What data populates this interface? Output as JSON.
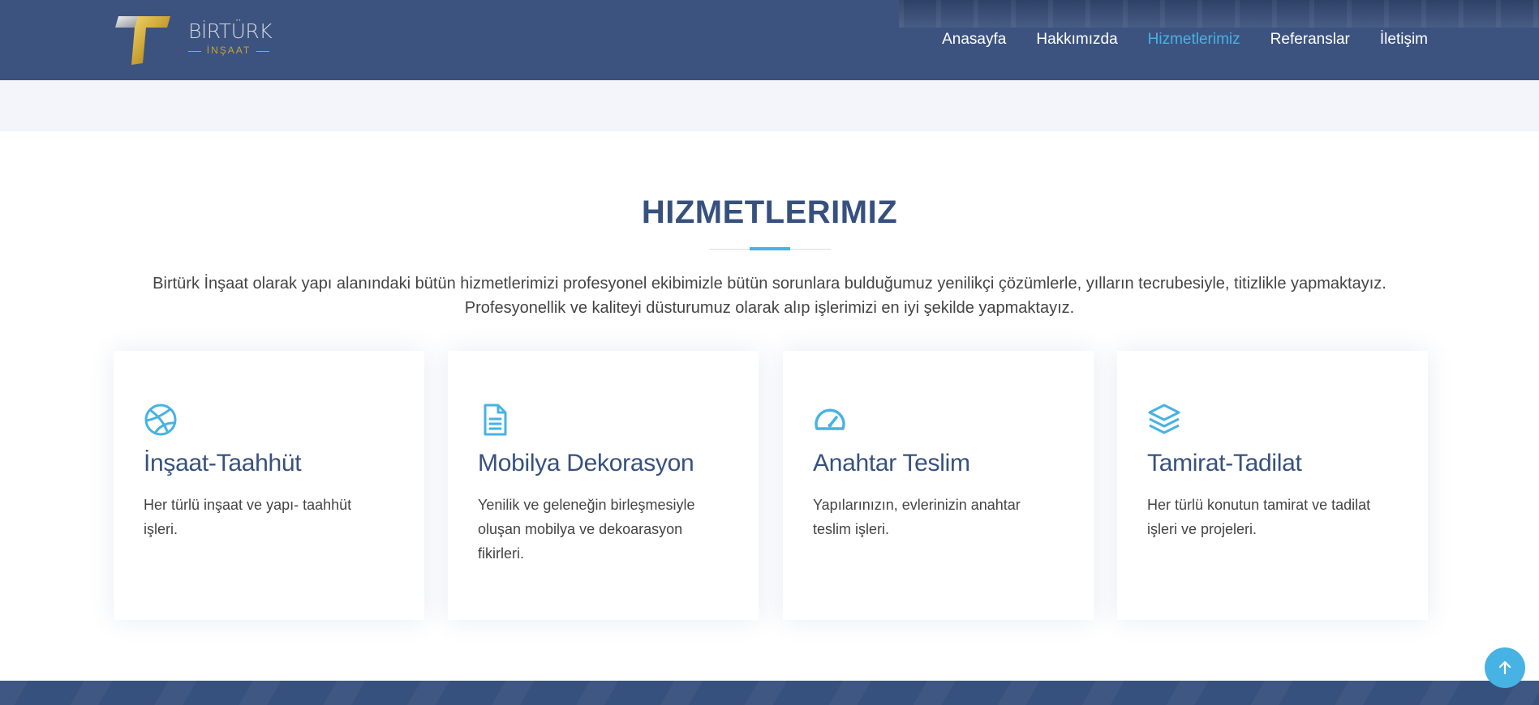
{
  "brand": {
    "name": "BİRTÜRK",
    "sub": "İNŞAAT",
    "colors": {
      "navy": "#3c5380",
      "gold": "#c9a233",
      "accent": "#47b2e4"
    }
  },
  "nav": {
    "items": [
      {
        "label": "Anasayfa"
      },
      {
        "label": "Hakkımızda"
      },
      {
        "label": "Hizmetlerimiz",
        "active": true
      },
      {
        "label": "Referanslar"
      },
      {
        "label": "İletişim"
      }
    ]
  },
  "services": {
    "title": "HIZMETLERIMIZ",
    "description_line1": "Birtürk İnşaat olarak yapı alanındaki bütün hizmetlerimizi profesyonel ekibimizle bütün sorunlara bulduğumuz yenilikçi çözümlerle, yılların tecrubesiyle, titizlikle yapmaktayız.",
    "description_line2": "Profesyonellik ve kaliteyi düsturumuz olarak alıp işlerimizi en iyi şekilde yapmaktayız.",
    "cards": [
      {
        "icon": "dribbble-icon",
        "title": "İnşaat-Taahhüt",
        "text": "Her türlü inşaat ve yapı- taahhüt işleri."
      },
      {
        "icon": "document-icon",
        "title": "Mobilya Dekorasyon",
        "text": "Yenilik ve geleneğin birleşmesiyle oluşan mobilya ve dekoarasyon fikirleri."
      },
      {
        "icon": "speedometer-icon",
        "title": "Anahtar Teslim",
        "text": "Yapılarınızın, evlerinizin anahtar teslim işleri."
      },
      {
        "icon": "layers-icon",
        "title": "Tamirat-Tadilat",
        "text": "Her türlü konutun tamirat ve tadilat işleri ve projeleri."
      }
    ]
  },
  "back_to_top": {
    "icon": "arrow-up-icon"
  }
}
